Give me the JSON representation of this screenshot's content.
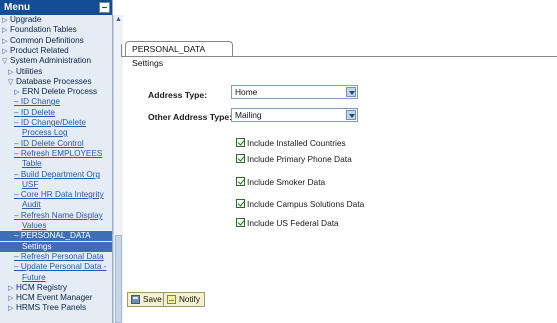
{
  "menu": {
    "title": "Menu",
    "items": [
      {
        "label": "Upgrade",
        "kind": "folder",
        "indent": 0
      },
      {
        "label": "Foundation Tables",
        "kind": "folder",
        "indent": 0
      },
      {
        "label": "Common Definitions",
        "kind": "folder",
        "indent": 0
      },
      {
        "label": "Product Related",
        "kind": "folder",
        "indent": 0
      },
      {
        "label": "System Administration",
        "kind": "open",
        "indent": 0
      },
      {
        "label": "Utilities",
        "kind": "folder",
        "indent": 1
      },
      {
        "label": "Database Processes",
        "kind": "open",
        "indent": 1
      },
      {
        "label": "ERN Delete Process",
        "kind": "folder",
        "indent": 2
      },
      {
        "label": "ID Change",
        "kind": "link",
        "indent": 2
      },
      {
        "label": "ID Delete",
        "kind": "link",
        "indent": 2
      },
      {
        "label": "ID Change/Delete",
        "kind": "link",
        "indent": 2
      },
      {
        "label": "Process Log",
        "kind": "link-cont",
        "indent": 2
      },
      {
        "label": "ID Delete Control",
        "kind": "link",
        "indent": 2
      },
      {
        "label": "Refresh EMPLOYEES",
        "kind": "link",
        "indent": 2
      },
      {
        "label": "Table",
        "kind": "link-cont",
        "indent": 2
      },
      {
        "label": "Build Department Org",
        "kind": "link",
        "indent": 2
      },
      {
        "label": "USF",
        "kind": "link-cont",
        "indent": 2
      },
      {
        "label": "Core HR Data Integrity",
        "kind": "link",
        "indent": 2
      },
      {
        "label": "Audit",
        "kind": "link-cont",
        "indent": 2
      },
      {
        "label": "Refresh Name Display",
        "kind": "link",
        "indent": 2
      },
      {
        "label": "Values",
        "kind": "link-cont",
        "indent": 2
      },
      {
        "label": "PERSONAL_DATA",
        "kind": "selected",
        "indent": 2
      },
      {
        "label": "Settings",
        "kind": "selected-cont",
        "indent": 2
      },
      {
        "label": "Refresh Personal Data",
        "kind": "link",
        "indent": 2
      },
      {
        "label": "Update Personal Data -",
        "kind": "link",
        "indent": 2
      },
      {
        "label": "Future",
        "kind": "link-cont",
        "indent": 2
      },
      {
        "label": "HCM Registry",
        "kind": "folder",
        "indent": 1
      },
      {
        "label": "HCM Event Manager",
        "kind": "folder",
        "indent": 1
      },
      {
        "label": "HRMS Tree Panels",
        "kind": "folder",
        "indent": 1
      }
    ]
  },
  "page": {
    "tab_label": "PERSONAL_DATA Settings",
    "address_type_label": "Address Type:",
    "address_type_value": "Home",
    "other_address_type_label": "Other Address Type:",
    "other_address_type_value": "Mailing",
    "checkboxes": [
      {
        "label": "Include Installed Countries",
        "checked": true
      },
      {
        "label": "Include Primary Phone Data",
        "checked": true
      },
      {
        "label": "Include Smoker Data",
        "checked": true
      },
      {
        "label": "Include Campus Solutions Data",
        "checked": true
      },
      {
        "label": "Include US Federal Data",
        "checked": true
      }
    ],
    "save_label": "Save",
    "notify_label": "Notify"
  }
}
